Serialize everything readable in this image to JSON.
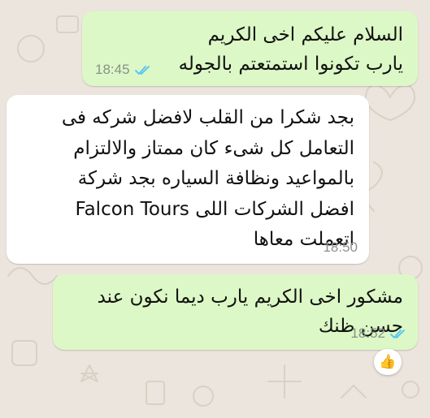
{
  "messages": [
    {
      "direction": "outgoing",
      "lines": [
        "السلام عليكم اخى الكريم",
        "يارب تكونوا استمتعتم بالجوله"
      ],
      "time": "18:45",
      "status": "read"
    },
    {
      "direction": "incoming",
      "lines": [
        "بجد شكرا من القلب لافضل شركه فى",
        "التعامل كل شىء كان ممتاز والالتزام",
        "بالمواعيد ونظافة السياره بجد شركة",
        "افضل الشركات اللى Falcon Tours",
        "اتعملت معاها"
      ],
      "time": "18:50"
    },
    {
      "direction": "outgoing",
      "lines": [
        "مشكور اخى الكريم يارب ديما نكون عند",
        "حسن ظنك"
      ],
      "time": "18:52",
      "status": "read",
      "reaction": "👍"
    }
  ],
  "colors": {
    "chat_background": "#ece5dd",
    "outgoing_bubble": "#dcf8c6",
    "incoming_bubble": "#ffffff",
    "read_ticks": "#4fc3f7",
    "timestamp": "#8a9289"
  },
  "icons": {
    "read_receipt": "double-check-icon",
    "reaction": "thumbs-up-icon"
  }
}
